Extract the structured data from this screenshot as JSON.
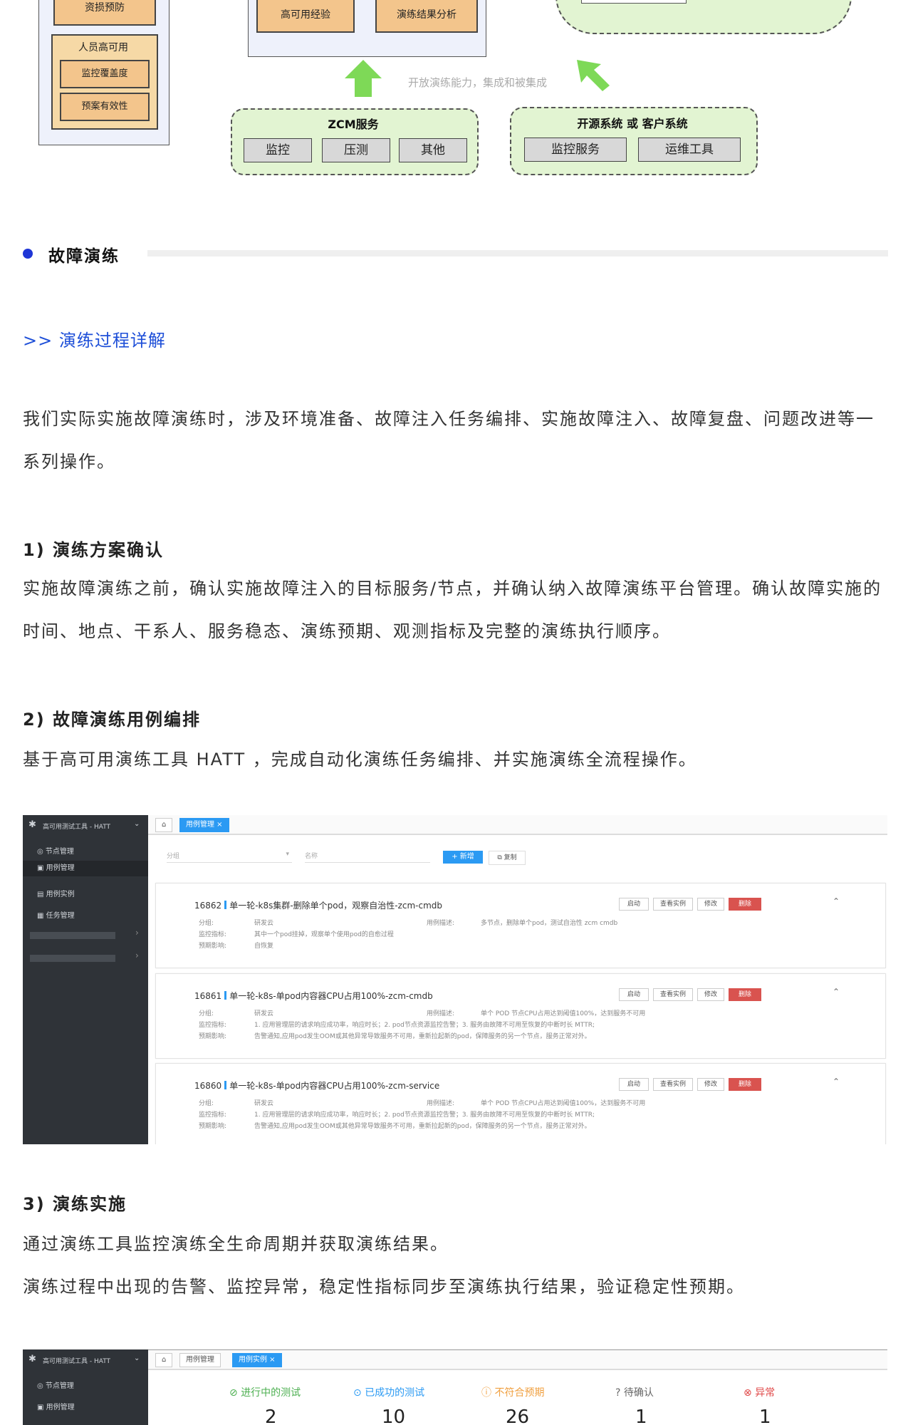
{
  "diagram": {
    "top_left_box": "资损预防",
    "personnel_panel_title": "人员高可用",
    "personnel_items": [
      "监控覆盖度",
      "预案有效性"
    ],
    "middle_boxes": [
      "高可用经验",
      "演练结果分析"
    ],
    "arrow_caption": "开放演练能力，集成和被集成",
    "zcm_title": "ZCM服务",
    "zcm_items": [
      "监控",
      "压测",
      "其他"
    ],
    "oss_title": "开源系统 或 客户系统",
    "oss_items": [
      "监控服务",
      "运维工具"
    ],
    "colors": {
      "orange": "#f3c58c",
      "green": "#e2f4d2",
      "arrow": "#7ed957",
      "blue_panel": "#eef1fb"
    }
  },
  "section": {
    "title": "故障演练",
    "subheading": ">>  演练过程详解",
    "intro": "我们实际实施故障演练时，涉及环境准备、故障注入任务编排、实施故障注入、故障复盘、问题改进等一系列操作。",
    "step1_title": "1) 演练方案确认",
    "step1_text": "实施故障演练之前，确认实施故障注入的目标服务/节点，并确认纳入故障演练平台管理。确认故障实施的时间、地点、干系人、服务稳态、演练预期、观测指标及完整的演练执行顺序。",
    "step2_title": "2) 故障演练用例编排",
    "step2_text": "基于高可用演练工具 HATT ，完成自动化演练任务编排、并实施演练全流程操作。",
    "step3_title": "3) 演练实施",
    "step3_text1": "通过演练工具监控演练全生命周期并获取演练结果。",
    "step3_text2": "演练过程中出现的告警、监控异常，稳定性指标同步至演练执行结果，验证稳定性预期。"
  },
  "shot1": {
    "app_title": "高可用测试工具 - HATT",
    "menu": [
      "节点管理",
      "用例管理",
      "用例实例",
      "任务管理"
    ],
    "tab_home": "⌂",
    "tab_active": "用例管理 ×",
    "filter_placeholder": "分组",
    "name_placeholder": "名称",
    "add_button": "+ 新增",
    "copy_button": "复制",
    "card_actions": [
      "启动",
      "查看实例",
      "修改",
      "删除"
    ],
    "cases": [
      {
        "id": "16862",
        "title": "单一轮-k8s集群-删除单个pod，观察自治性-zcm-cmdb",
        "group_label": "分组:",
        "group_value": "研发云",
        "desc_label": "用例描述:",
        "desc_value": "多节点，删除单个pod，测试自治性 zcm cmdb",
        "monitor_label": "监控指标:",
        "monitor_value": "其中一个pod挂掉，观察单个使用pod的自愈过程",
        "expect_label": "预期影响:",
        "expect_value": "自恢复"
      },
      {
        "id": "16861",
        "title": "单一轮-k8s-单pod内容器CPU占用100%-zcm-cmdb",
        "group_label": "分组:",
        "group_value": "研发云",
        "desc_label": "用例描述:",
        "desc_value": "单个 POD 节点CPU占用达到阈值100%，达到服务不可用",
        "monitor_label": "监控指标:",
        "monitor_value": "1. 应用管理层的请求响应成功率，响应时长；2. pod节点资源监控告警；3. 服务由故障不可用至恢复的中断时长 MTTR;",
        "expect_label": "预期影响:",
        "expect_value": "告警通知,应用pod发生OOM或其他异常导致服务不可用，重新拉起新的pod，保障服务的另一个节点，服务正常对外。"
      },
      {
        "id": "16860",
        "title": "单一轮-k8s-单pod内容器CPU占用100%-zcm-service",
        "group_label": "分组:",
        "group_value": "研发云",
        "desc_label": "用例描述:",
        "desc_value": "单个 POD 节点CPU占用达到阈值100%，达到服务不可用",
        "monitor_label": "监控指标:",
        "monitor_value": "1. 应用管理层的请求响应成功率，响应时长；2. pod节点资源监控告警；3. 服务由故障不可用至恢复的中断时长 MTTR;",
        "expect_label": "预期影响:",
        "expect_value": "告警通知,应用pod发生OOM或其他异常导致服务不可用，重新拉起新的pod，保障服务的另一个节点，服务正常对外。"
      }
    ]
  },
  "shot2": {
    "app_title": "高可用测试工具 - HATT",
    "menu": [
      "节点管理",
      "用例管理"
    ],
    "tabs": [
      "⌂",
      "用例管理",
      "用例实例 ×"
    ],
    "stats": [
      {
        "label": "进行中的测试",
        "value": "2",
        "color": "#4caf50",
        "icon": "⊘"
      },
      {
        "label": "已成功的测试",
        "value": "10",
        "color": "#2b9af3",
        "icon": "⊙"
      },
      {
        "label": "不符合预期",
        "value": "26",
        "color": "#f0a040",
        "icon": "ⓘ"
      },
      {
        "label": "待确认",
        "value": "1",
        "color": "#666666",
        "icon": "?"
      },
      {
        "label": "异常",
        "value": "1",
        "color": "#e04848",
        "icon": "⊗"
      }
    ]
  }
}
